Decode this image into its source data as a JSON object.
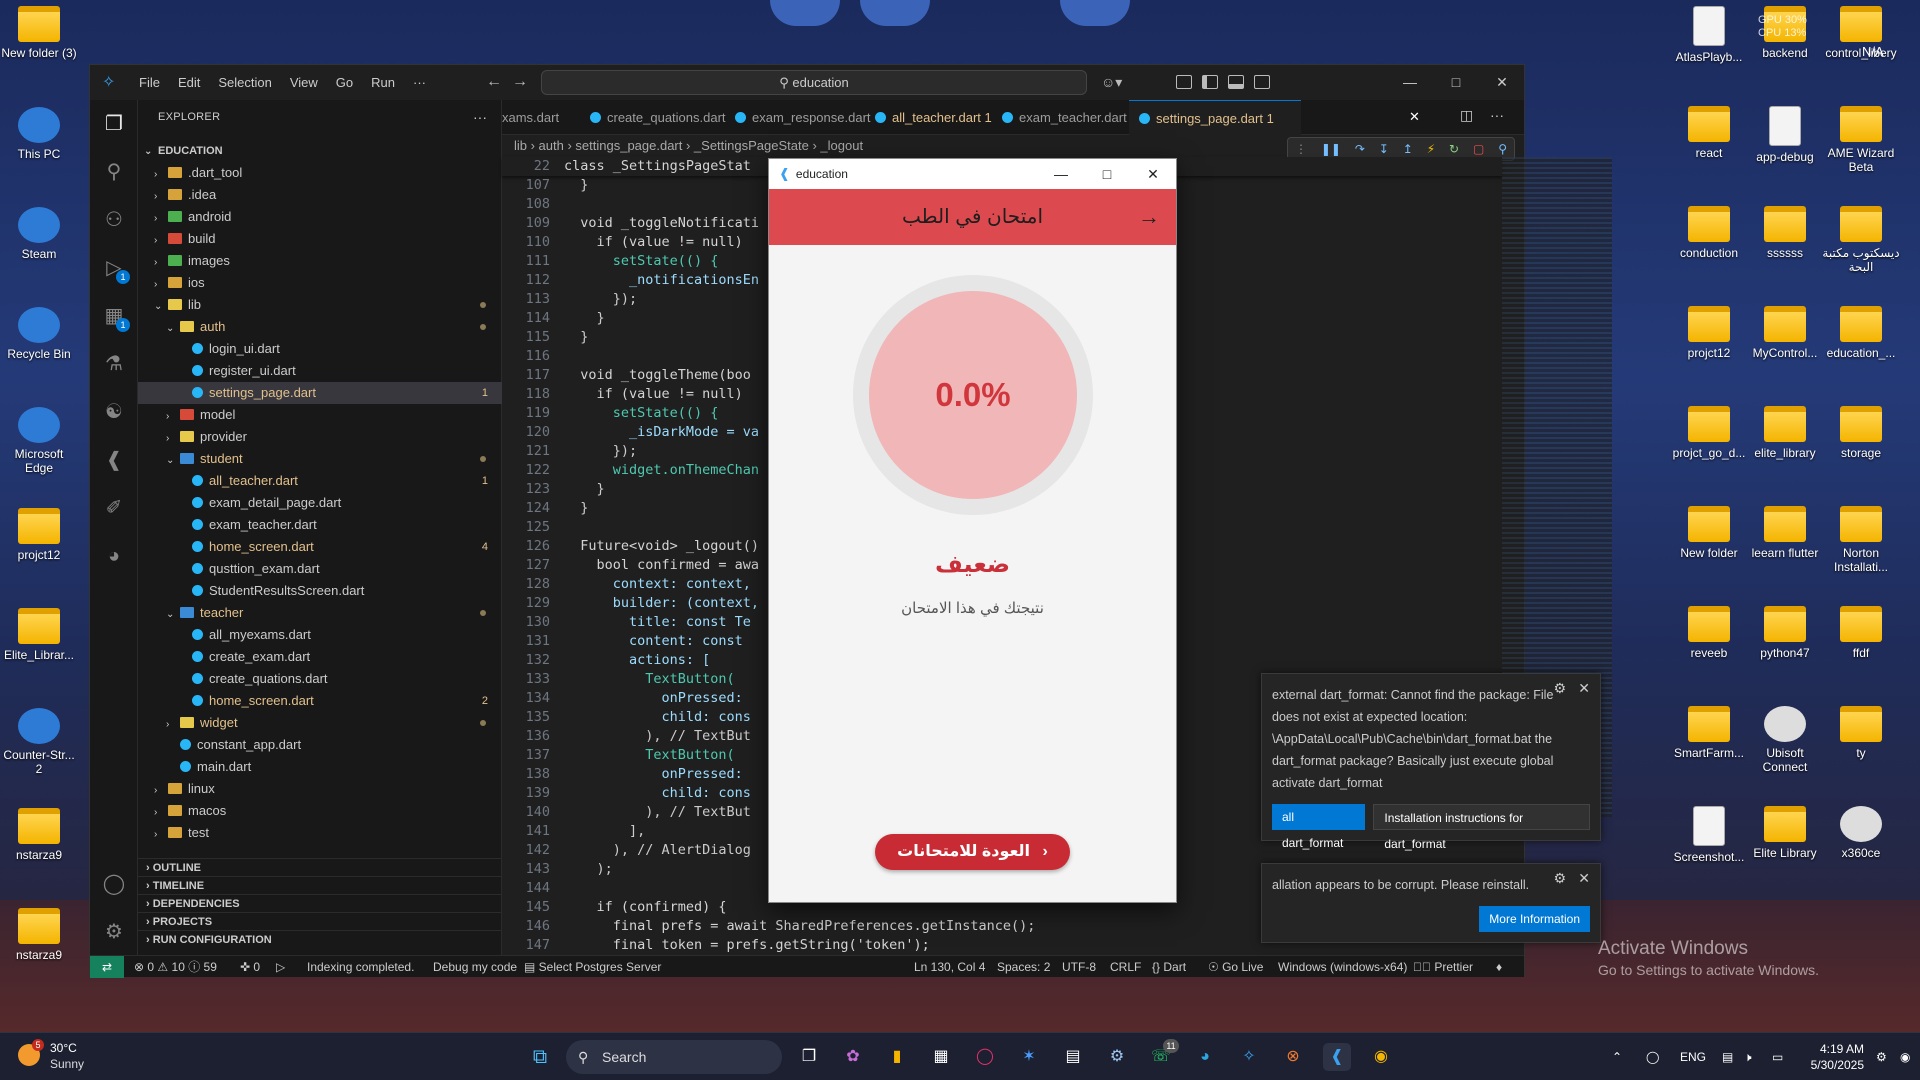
{
  "colors": {
    "vscode_bg": "#1f1f1f",
    "accent_blue": "#0078d4",
    "flutter_appbar": "#dc4a4f",
    "gauge_fill": "#f1b6b7",
    "score_red": "#d0363b",
    "button_red": "#c82b33"
  },
  "desktop_left": [
    {
      "label": "New folder (3)",
      "icon": "folder-icon"
    },
    {
      "label": "This PC",
      "icon": "computer-icon"
    },
    {
      "label": "Steam",
      "icon": "steam-icon"
    },
    {
      "label": "Recycle Bin",
      "icon": "recycle-bin-icon"
    },
    {
      "label": "Microsoft Edge",
      "icon": "edge-icon"
    },
    {
      "label": "projct12",
      "icon": "folder-icon"
    },
    {
      "label": "Elite_Librar...",
      "icon": "folder-icon"
    },
    {
      "label": "Counter-Str... 2",
      "icon": "game-icon"
    },
    {
      "label": "nstarza9",
      "icon": "folder-icon"
    },
    {
      "label": "nstarza9",
      "icon": "folder-icon"
    }
  ],
  "desktop_right": [
    {
      "label": "AtlasPlayb...",
      "icon": "document-icon"
    },
    {
      "label": "backend",
      "icon": "folder-icon"
    },
    {
      "label": "control_libery",
      "icon": "folder-icon"
    },
    {
      "label": "react",
      "icon": "folder-icon"
    },
    {
      "label": "app-debug",
      "icon": "document-icon"
    },
    {
      "label": "AME Wizard Beta",
      "icon": "folder-icon"
    },
    {
      "label": "conduction",
      "icon": "folder-icon"
    },
    {
      "label": "ssssss",
      "icon": "folder-icon"
    },
    {
      "label": "ديسكتوب مكتبة البحة",
      "icon": "folder-icon"
    },
    {
      "label": "projct12",
      "icon": "folder-icon"
    },
    {
      "label": "MyControl...",
      "icon": "folder-icon"
    },
    {
      "label": "education_...",
      "icon": "folder-icon"
    },
    {
      "label": "projct_go_d...",
      "icon": "folder-icon"
    },
    {
      "label": "elite_library",
      "icon": "folder-icon"
    },
    {
      "label": "storage",
      "icon": "folder-icon"
    },
    {
      "label": "New folder",
      "icon": "folder-icon"
    },
    {
      "label": "leearn flutter",
      "icon": "folder-icon"
    },
    {
      "label": "Norton Installati...",
      "icon": "folder-icon"
    },
    {
      "label": "reveeb",
      "icon": "folder-icon"
    },
    {
      "label": "python47",
      "icon": "folder-icon"
    },
    {
      "label": "ffdf",
      "icon": "folder-icon"
    },
    {
      "label": "SmartFarm...",
      "icon": "folder-icon"
    },
    {
      "label": "Ubisoft Connect",
      "icon": "ubisoft-icon"
    },
    {
      "label": "ty",
      "icon": "folder-icon"
    },
    {
      "label": "Screenshot...",
      "icon": "document-icon"
    },
    {
      "label": "Elite Library",
      "icon": "folder-icon"
    },
    {
      "label": "x360ce",
      "icon": "gamepad-icon"
    }
  ],
  "gpu_overlay": {
    "line1": "GPU 30%",
    "line2": "CPU 13%",
    "line3": "N/A"
  },
  "vscode": {
    "menus": [
      "File",
      "Edit",
      "Selection",
      "View",
      "Go",
      "Run",
      "···"
    ],
    "search_text": "education",
    "explorer_title": "EXPLORER",
    "workspace": "EDUCATION",
    "tree": [
      {
        "label": ".dart_tool",
        "type": "folder",
        "depth": 1,
        "open": false
      },
      {
        "label": ".idea",
        "type": "folder",
        "depth": 1,
        "open": false
      },
      {
        "label": "android",
        "type": "folder-green",
        "depth": 1,
        "open": false
      },
      {
        "label": "build",
        "type": "folder-red",
        "depth": 1,
        "open": false
      },
      {
        "label": "images",
        "type": "folder-green",
        "depth": 1,
        "open": false
      },
      {
        "label": "ios",
        "type": "folder",
        "depth": 1,
        "open": false
      },
      {
        "label": "lib",
        "type": "folder-y",
        "depth": 1,
        "open": true,
        "dot": true
      },
      {
        "label": "auth",
        "type": "folder-y",
        "depth": 2,
        "open": true,
        "mod": true,
        "dot": true
      },
      {
        "label": "login_ui.dart",
        "type": "dart",
        "depth": 3
      },
      {
        "label": "register_ui.dart",
        "type": "dart",
        "depth": 3
      },
      {
        "label": "settings_page.dart",
        "type": "dart",
        "depth": 3,
        "mod": true,
        "badge": "1"
      },
      {
        "label": "model",
        "type": "folder-red",
        "depth": 2,
        "open": false
      },
      {
        "label": "provider",
        "type": "folder-y",
        "depth": 2,
        "open": false
      },
      {
        "label": "student",
        "type": "folder-blue",
        "depth": 2,
        "open": true,
        "mod": true,
        "dot": true
      },
      {
        "label": "all_teacher.dart",
        "type": "dart",
        "depth": 3,
        "mod": true,
        "badge": "1"
      },
      {
        "label": "exam_detail_page.dart",
        "type": "dart",
        "depth": 3
      },
      {
        "label": "exam_teacher.dart",
        "type": "dart",
        "depth": 3
      },
      {
        "label": "home_screen.dart",
        "type": "dart",
        "depth": 3,
        "mod": true,
        "badge": "4"
      },
      {
        "label": "qusttion_exam.dart",
        "type": "dart",
        "depth": 3
      },
      {
        "label": "StudentResultsScreen.dart",
        "type": "dart",
        "depth": 3
      },
      {
        "label": "teacher",
        "type": "folder-blue",
        "depth": 2,
        "open": true,
        "mod": true,
        "dot": true
      },
      {
        "label": "all_myexams.dart",
        "type": "dart",
        "depth": 3
      },
      {
        "label": "create_exam.dart",
        "type": "dart",
        "depth": 3
      },
      {
        "label": "create_quations.dart",
        "type": "dart",
        "depth": 3
      },
      {
        "label": "home_screen.dart",
        "type": "dart",
        "depth": 3,
        "mod": true,
        "badge": "2"
      },
      {
        "label": "widget",
        "type": "folder-y",
        "depth": 2,
        "open": false,
        "mod": true,
        "dot": true
      },
      {
        "label": "constant_app.dart",
        "type": "dart",
        "depth": 2
      },
      {
        "label": "main.dart",
        "type": "dart",
        "depth": 2
      },
      {
        "label": "linux",
        "type": "folder",
        "depth": 1,
        "open": false
      },
      {
        "label": "macos",
        "type": "folder",
        "depth": 1,
        "open": false
      },
      {
        "label": "test",
        "type": "folder",
        "depth": 1,
        "open": false
      }
    ],
    "sections": [
      "OUTLINE",
      "TIMELINE",
      "DEPENDENCIES",
      "PROJECTS",
      "RUN CONFIGURATION"
    ],
    "tabs": [
      {
        "label": "xams.dart",
        "active": false,
        "mod": false
      },
      {
        "label": "create_quations.dart",
        "active": false,
        "mod": false
      },
      {
        "label": "exam_response.dart",
        "active": false,
        "mod": false
      },
      {
        "label": "all_teacher.dart 1",
        "active": false,
        "mod": true
      },
      {
        "label": "exam_teacher.dart",
        "active": false,
        "mod": false
      },
      {
        "label": "settings_page.dart 1",
        "active": true,
        "mod": true
      }
    ],
    "breadcrumb": "lib  ›  auth  ›  settings_page.dart  ›  _SettingsPageState  ›  _logout",
    "code": [
      {
        "n": "22",
        "t": "class _SettingsPageStat"
      },
      {
        "n": "107",
        "t": "  }"
      },
      {
        "n": "108",
        "t": ""
      },
      {
        "n": "109",
        "t": "  void _toggleNotificati"
      },
      {
        "n": "110",
        "t": "    if (value != null) "
      },
      {
        "n": "111",
        "t": "      setState(() {"
      },
      {
        "n": "112",
        "t": "        _notificationsEn"
      },
      {
        "n": "113",
        "t": "      });"
      },
      {
        "n": "114",
        "t": "    }"
      },
      {
        "n": "115",
        "t": "  }"
      },
      {
        "n": "116",
        "t": ""
      },
      {
        "n": "117",
        "t": "  void _toggleTheme(boo"
      },
      {
        "n": "118",
        "t": "    if (value != null) "
      },
      {
        "n": "119",
        "t": "      setState(() {"
      },
      {
        "n": "120",
        "t": "        _isDarkMode = va"
      },
      {
        "n": "121",
        "t": "      });"
      },
      {
        "n": "122",
        "t": "      widget.onThemeChan"
      },
      {
        "n": "123",
        "t": "    }"
      },
      {
        "n": "124",
        "t": "  }"
      },
      {
        "n": "125",
        "t": ""
      },
      {
        "n": "126",
        "t": "  Future<void> _logout()"
      },
      {
        "n": "127",
        "t": "    bool confirmed = awa"
      },
      {
        "n": "128",
        "t": "      context: context,"
      },
      {
        "n": "129",
        "t": "      builder: (context,"
      },
      {
        "n": "130",
        "t": "        title: const Te"
      },
      {
        "n": "131",
        "t": "        content: const "
      },
      {
        "n": "132",
        "t": "        actions: ["
      },
      {
        "n": "133",
        "t": "          TextButton("
      },
      {
        "n": "134",
        "t": "            onPressed: "
      },
      {
        "n": "135",
        "t": "            child: cons"
      },
      {
        "n": "136",
        "t": "          ), // TextBut"
      },
      {
        "n": "137",
        "t": "          TextButton("
      },
      {
        "n": "138",
        "t": "            onPressed: "
      },
      {
        "n": "139",
        "t": "            child: cons"
      },
      {
        "n": "140",
        "t": "          ), // TextBut"
      },
      {
        "n": "141",
        "t": "        ],"
      },
      {
        "n": "142",
        "t": "      ), // AlertDialog"
      },
      {
        "n": "143",
        "t": "    );"
      },
      {
        "n": "144",
        "t": ""
      },
      {
        "n": "145",
        "t": "    if (confirmed) {"
      },
      {
        "n": "146",
        "t": "      final prefs = await SharedPreferences.getInstance();"
      },
      {
        "n": "147",
        "t": "      final token = prefs.getString('token');"
      }
    ],
    "notifications": [
      {
        "text": "external dart_format: Cannot find the package: File does not exist at expected location: \\AppData\\Local\\Pub\\Cache\\bin\\dart_format.bat the dart_format package? Basically just execute global activate dart_format",
        "primary": "all dart_format",
        "secondary": "Installation instructions for dart_format"
      },
      {
        "text": "allation appears to be corrupt. Please reinstall.",
        "primary": "More Information"
      }
    ],
    "status": {
      "errors": "0",
      "warnings": "10",
      "infos": "59",
      "ports": "0",
      "indexing": "Indexing completed.",
      "debug": "Debug my code",
      "postgres": "Select Postgres Server",
      "position": "Ln 130, Col 4",
      "spaces": "Spaces: 2",
      "encoding": "UTF-8",
      "eol": "CRLF",
      "language": "Dart",
      "golive": "Go Live",
      "target": "Windows (windows-x64)",
      "prettier": "Prettier"
    }
  },
  "flutter_app": {
    "window_title": "education",
    "appbar_title": "امتحان في الطب",
    "score_percent": 0.0,
    "score_label": "0.0%",
    "grade": "ضعيف",
    "subtitle": "نتيجتك في هذا الامتحان",
    "back_button": "العودة للامتحانات"
  },
  "watermark": {
    "line1": "Activate Windows",
    "line2": "Go to Settings to activate Windows."
  },
  "taskbar": {
    "weather_temp": "30°C",
    "weather_desc": "Sunny",
    "weather_badge": "5",
    "search_placeholder": "Search",
    "whatsapp_badge": "11",
    "lang": "ENG",
    "time": "4:19 AM",
    "date": "5/30/2025"
  }
}
